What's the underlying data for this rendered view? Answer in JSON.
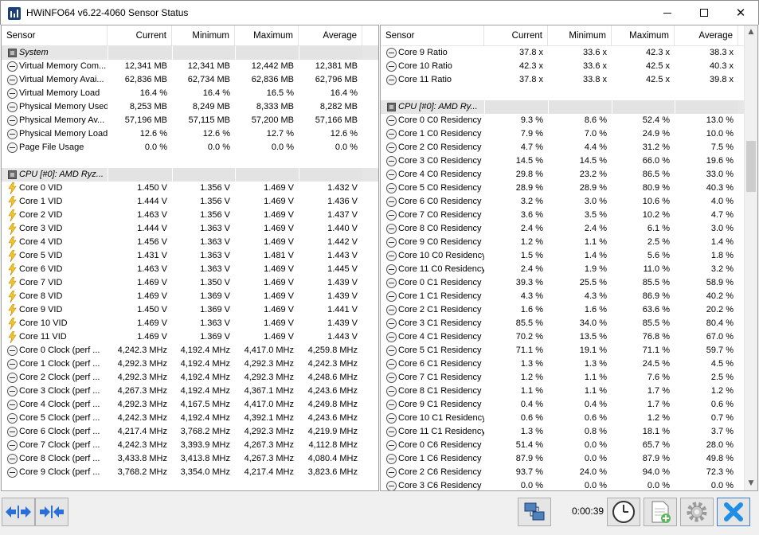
{
  "window": {
    "title": "HWiNFO64 v6.22-4060 Sensor Status",
    "minimize_glyph": "—",
    "maximize_glyph": "☐",
    "close_glyph": "✕"
  },
  "columns": {
    "sensor": "Sensor",
    "current": "Current",
    "minimum": "Minimum",
    "maximum": "Maximum",
    "average": "Average"
  },
  "left_rows": [
    {
      "kind": "group",
      "icon": "chip-icon",
      "name": "System"
    },
    {
      "kind": "row",
      "icon": "gauge-icon",
      "name": "Virtual Memory Com...",
      "current": "12,341 MB",
      "minimum": "12,341 MB",
      "maximum": "12,442 MB",
      "average": "12,381 MB"
    },
    {
      "kind": "row",
      "icon": "gauge-icon",
      "name": "Virtual Memory Avai...",
      "current": "62,836 MB",
      "minimum": "62,734 MB",
      "maximum": "62,836 MB",
      "average": "62,796 MB"
    },
    {
      "kind": "row",
      "icon": "gauge-icon",
      "name": "Virtual Memory Load",
      "current": "16.4 %",
      "minimum": "16.4 %",
      "maximum": "16.5 %",
      "average": "16.4 %"
    },
    {
      "kind": "row",
      "icon": "gauge-icon",
      "name": "Physical Memory Used",
      "current": "8,253 MB",
      "minimum": "8,249 MB",
      "maximum": "8,333 MB",
      "average": "8,282 MB"
    },
    {
      "kind": "row",
      "icon": "gauge-icon",
      "name": "Physical Memory Av...",
      "current": "57,196 MB",
      "minimum": "57,115 MB",
      "maximum": "57,200 MB",
      "average": "57,166 MB"
    },
    {
      "kind": "row",
      "icon": "gauge-icon",
      "name": "Physical Memory Load",
      "current": "12.6 %",
      "minimum": "12.6 %",
      "maximum": "12.7 %",
      "average": "12.6 %"
    },
    {
      "kind": "row",
      "icon": "gauge-icon",
      "name": "Page File Usage",
      "current": "0.0 %",
      "minimum": "0.0 %",
      "maximum": "0.0 %",
      "average": "0.0 %"
    },
    {
      "kind": "blank"
    },
    {
      "kind": "group",
      "icon": "chip-icon",
      "name": "CPU [#0]: AMD Ryz..."
    },
    {
      "kind": "row",
      "icon": "bolt-icon",
      "name": "Core 0 VID",
      "current": "1.450 V",
      "minimum": "1.356 V",
      "maximum": "1.469 V",
      "average": "1.432 V"
    },
    {
      "kind": "row",
      "icon": "bolt-icon",
      "name": "Core 1 VID",
      "current": "1.444 V",
      "minimum": "1.356 V",
      "maximum": "1.469 V",
      "average": "1.436 V"
    },
    {
      "kind": "row",
      "icon": "bolt-icon",
      "name": "Core 2 VID",
      "current": "1.463 V",
      "minimum": "1.356 V",
      "maximum": "1.469 V",
      "average": "1.437 V"
    },
    {
      "kind": "row",
      "icon": "bolt-icon",
      "name": "Core 3 VID",
      "current": "1.444 V",
      "minimum": "1.363 V",
      "maximum": "1.469 V",
      "average": "1.440 V"
    },
    {
      "kind": "row",
      "icon": "bolt-icon",
      "name": "Core 4 VID",
      "current": "1.456 V",
      "minimum": "1.363 V",
      "maximum": "1.469 V",
      "average": "1.442 V"
    },
    {
      "kind": "row",
      "icon": "bolt-icon",
      "name": "Core 5 VID",
      "current": "1.431 V",
      "minimum": "1.363 V",
      "maximum": "1.481 V",
      "average": "1.443 V"
    },
    {
      "kind": "row",
      "icon": "bolt-icon",
      "name": "Core 6 VID",
      "current": "1.463 V",
      "minimum": "1.363 V",
      "maximum": "1.469 V",
      "average": "1.445 V"
    },
    {
      "kind": "row",
      "icon": "bolt-icon",
      "name": "Core 7 VID",
      "current": "1.469 V",
      "minimum": "1.350 V",
      "maximum": "1.469 V",
      "average": "1.439 V"
    },
    {
      "kind": "row",
      "icon": "bolt-icon",
      "name": "Core 8 VID",
      "current": "1.469 V",
      "minimum": "1.369 V",
      "maximum": "1.469 V",
      "average": "1.439 V"
    },
    {
      "kind": "row",
      "icon": "bolt-icon",
      "name": "Core 9 VID",
      "current": "1.450 V",
      "minimum": "1.369 V",
      "maximum": "1.469 V",
      "average": "1.441 V"
    },
    {
      "kind": "row",
      "icon": "bolt-icon",
      "name": "Core 10 VID",
      "current": "1.469 V",
      "minimum": "1.363 V",
      "maximum": "1.469 V",
      "average": "1.439 V"
    },
    {
      "kind": "row",
      "icon": "bolt-icon",
      "name": "Core 11 VID",
      "current": "1.469 V",
      "minimum": "1.369 V",
      "maximum": "1.469 V",
      "average": "1.443 V"
    },
    {
      "kind": "row",
      "icon": "gauge-icon",
      "name": "Core 0 Clock (perf ...",
      "current": "4,242.3 MHz",
      "minimum": "4,192.4 MHz",
      "maximum": "4,417.0 MHz",
      "average": "4,259.8 MHz"
    },
    {
      "kind": "row",
      "icon": "gauge-icon",
      "name": "Core 1 Clock (perf ...",
      "current": "4,292.3 MHz",
      "minimum": "4,192.4 MHz",
      "maximum": "4,292.3 MHz",
      "average": "4,242.3 MHz"
    },
    {
      "kind": "row",
      "icon": "gauge-icon",
      "name": "Core 2 Clock (perf ...",
      "current": "4,292.3 MHz",
      "minimum": "4,192.4 MHz",
      "maximum": "4,292.3 MHz",
      "average": "4,248.6 MHz"
    },
    {
      "kind": "row",
      "icon": "gauge-icon",
      "name": "Core 3 Clock (perf ...",
      "current": "4,267.3 MHz",
      "minimum": "4,192.4 MHz",
      "maximum": "4,367.1 MHz",
      "average": "4,243.6 MHz"
    },
    {
      "kind": "row",
      "icon": "gauge-icon",
      "name": "Core 4 Clock (perf ...",
      "current": "4,292.3 MHz",
      "minimum": "4,167.5 MHz",
      "maximum": "4,417.0 MHz",
      "average": "4,249.8 MHz"
    },
    {
      "kind": "row",
      "icon": "gauge-icon",
      "name": "Core 5 Clock (perf ...",
      "current": "4,242.3 MHz",
      "minimum": "4,192.4 MHz",
      "maximum": "4,392.1 MHz",
      "average": "4,243.6 MHz"
    },
    {
      "kind": "row",
      "icon": "gauge-icon",
      "name": "Core 6 Clock (perf ...",
      "current": "4,217.4 MHz",
      "minimum": "3,768.2 MHz",
      "maximum": "4,292.3 MHz",
      "average": "4,219.9 MHz"
    },
    {
      "kind": "row",
      "icon": "gauge-icon",
      "name": "Core 7 Clock (perf ...",
      "current": "4,242.3 MHz",
      "minimum": "3,393.9 MHz",
      "maximum": "4,267.3 MHz",
      "average": "4,112.8 MHz"
    },
    {
      "kind": "row",
      "icon": "gauge-icon",
      "name": "Core 8 Clock (perf ...",
      "current": "3,433.8 MHz",
      "minimum": "3,413.8 MHz",
      "maximum": "4,267.3 MHz",
      "average": "4,080.4 MHz"
    },
    {
      "kind": "row",
      "icon": "gauge-icon",
      "name": "Core 9 Clock (perf ...",
      "current": "3,768.2 MHz",
      "minimum": "3,354.0 MHz",
      "maximum": "4,217.4 MHz",
      "average": "3,823.6 MHz"
    }
  ],
  "right_rows": [
    {
      "kind": "row",
      "icon": "gauge-icon",
      "name": "Core 9 Ratio",
      "current": "37.8 x",
      "minimum": "33.6 x",
      "maximum": "42.3 x",
      "average": "38.3 x"
    },
    {
      "kind": "row",
      "icon": "gauge-icon",
      "name": "Core 10 Ratio",
      "current": "42.3 x",
      "minimum": "33.6 x",
      "maximum": "42.5 x",
      "average": "40.3 x"
    },
    {
      "kind": "row",
      "icon": "gauge-icon",
      "name": "Core 11 Ratio",
      "current": "37.8 x",
      "minimum": "33.8 x",
      "maximum": "42.5 x",
      "average": "39.8 x"
    },
    {
      "kind": "blank"
    },
    {
      "kind": "group",
      "icon": "chip-icon",
      "name": "CPU [#0]: AMD Ry..."
    },
    {
      "kind": "row",
      "icon": "gauge-icon",
      "name": "Core 0 C0 Residency",
      "current": "9.3 %",
      "minimum": "8.6 %",
      "maximum": "52.4 %",
      "average": "13.0 %"
    },
    {
      "kind": "row",
      "icon": "gauge-icon",
      "name": "Core 1 C0 Residency",
      "current": "7.9 %",
      "minimum": "7.0 %",
      "maximum": "24.9 %",
      "average": "10.0 %"
    },
    {
      "kind": "row",
      "icon": "gauge-icon",
      "name": "Core 2 C0 Residency",
      "current": "4.7 %",
      "minimum": "4.4 %",
      "maximum": "31.2 %",
      "average": "7.5 %"
    },
    {
      "kind": "row",
      "icon": "gauge-icon",
      "name": "Core 3 C0 Residency",
      "current": "14.5 %",
      "minimum": "14.5 %",
      "maximum": "66.0 %",
      "average": "19.6 %"
    },
    {
      "kind": "row",
      "icon": "gauge-icon",
      "name": "Core 4 C0 Residency",
      "current": "29.8 %",
      "minimum": "23.2 %",
      "maximum": "86.5 %",
      "average": "33.0 %"
    },
    {
      "kind": "row",
      "icon": "gauge-icon",
      "name": "Core 5 C0 Residency",
      "current": "28.9 %",
      "minimum": "28.9 %",
      "maximum": "80.9 %",
      "average": "40.3 %"
    },
    {
      "kind": "row",
      "icon": "gauge-icon",
      "name": "Core 6 C0 Residency",
      "current": "3.2 %",
      "minimum": "3.0 %",
      "maximum": "10.6 %",
      "average": "4.0 %"
    },
    {
      "kind": "row",
      "icon": "gauge-icon",
      "name": "Core 7 C0 Residency",
      "current": "3.6 %",
      "minimum": "3.5 %",
      "maximum": "10.2 %",
      "average": "4.7 %"
    },
    {
      "kind": "row",
      "icon": "gauge-icon",
      "name": "Core 8 C0 Residency",
      "current": "2.4 %",
      "minimum": "2.4 %",
      "maximum": "6.1 %",
      "average": "3.0 %"
    },
    {
      "kind": "row",
      "icon": "gauge-icon",
      "name": "Core 9 C0 Residency",
      "current": "1.2 %",
      "minimum": "1.1 %",
      "maximum": "2.5 %",
      "average": "1.4 %"
    },
    {
      "kind": "row",
      "icon": "gauge-icon",
      "name": "Core 10 C0 Residency",
      "current": "1.5 %",
      "minimum": "1.4 %",
      "maximum": "5.6 %",
      "average": "1.8 %"
    },
    {
      "kind": "row",
      "icon": "gauge-icon",
      "name": "Core 11 C0 Residency",
      "current": "2.4 %",
      "minimum": "1.9 %",
      "maximum": "11.0 %",
      "average": "3.2 %"
    },
    {
      "kind": "row",
      "icon": "gauge-icon",
      "name": "Core 0 C1 Residency",
      "current": "39.3 %",
      "minimum": "25.5 %",
      "maximum": "85.5 %",
      "average": "58.9 %"
    },
    {
      "kind": "row",
      "icon": "gauge-icon",
      "name": "Core 1 C1 Residency",
      "current": "4.3 %",
      "minimum": "4.3 %",
      "maximum": "86.9 %",
      "average": "40.2 %"
    },
    {
      "kind": "row",
      "icon": "gauge-icon",
      "name": "Core 2 C1 Residency",
      "current": "1.6 %",
      "minimum": "1.6 %",
      "maximum": "63.6 %",
      "average": "20.2 %"
    },
    {
      "kind": "row",
      "icon": "gauge-icon",
      "name": "Core 3 C1 Residency",
      "current": "85.5 %",
      "minimum": "34.0 %",
      "maximum": "85.5 %",
      "average": "80.4 %"
    },
    {
      "kind": "row",
      "icon": "gauge-icon",
      "name": "Core 4 C1 Residency",
      "current": "70.2 %",
      "minimum": "13.5 %",
      "maximum": "76.8 %",
      "average": "67.0 %"
    },
    {
      "kind": "row",
      "icon": "gauge-icon",
      "name": "Core 5 C1 Residency",
      "current": "71.1 %",
      "minimum": "19.1 %",
      "maximum": "71.1 %",
      "average": "59.7 %"
    },
    {
      "kind": "row",
      "icon": "gauge-icon",
      "name": "Core 6 C1 Residency",
      "current": "1.3 %",
      "minimum": "1.3 %",
      "maximum": "24.5 %",
      "average": "4.5 %"
    },
    {
      "kind": "row",
      "icon": "gauge-icon",
      "name": "Core 7 C1 Residency",
      "current": "1.2 %",
      "minimum": "1.1 %",
      "maximum": "7.6 %",
      "average": "2.5 %"
    },
    {
      "kind": "row",
      "icon": "gauge-icon",
      "name": "Core 8 C1 Residency",
      "current": "1.1 %",
      "minimum": "1.1 %",
      "maximum": "1.7 %",
      "average": "1.2 %"
    },
    {
      "kind": "row",
      "icon": "gauge-icon",
      "name": "Core 9 C1 Residency",
      "current": "0.4 %",
      "minimum": "0.4 %",
      "maximum": "1.7 %",
      "average": "0.6 %"
    },
    {
      "kind": "row",
      "icon": "gauge-icon",
      "name": "Core 10 C1 Residency",
      "current": "0.6 %",
      "minimum": "0.6 %",
      "maximum": "1.2 %",
      "average": "0.7 %"
    },
    {
      "kind": "row",
      "icon": "gauge-icon",
      "name": "Core 11 C1 Residency",
      "current": "1.3 %",
      "minimum": "0.8 %",
      "maximum": "18.1 %",
      "average": "3.7 %"
    },
    {
      "kind": "row",
      "icon": "gauge-icon",
      "name": "Core 0 C6 Residency",
      "current": "51.4 %",
      "minimum": "0.0 %",
      "maximum": "65.7 %",
      "average": "28.0 %"
    },
    {
      "kind": "row",
      "icon": "gauge-icon",
      "name": "Core 1 C6 Residency",
      "current": "87.9 %",
      "minimum": "0.0 %",
      "maximum": "87.9 %",
      "average": "49.8 %"
    },
    {
      "kind": "row",
      "icon": "gauge-icon",
      "name": "Core 2 C6 Residency",
      "current": "93.7 %",
      "minimum": "24.0 %",
      "maximum": "94.0 %",
      "average": "72.3 %"
    },
    {
      "kind": "row",
      "icon": "gauge-icon",
      "name": "Core 3 C6 Residency",
      "current": "0.0 %",
      "minimum": "0.0 %",
      "maximum": "0.0 %",
      "average": "0.0 %"
    }
  ],
  "toolbar": {
    "elapsed_time": "0:00:39",
    "buttons": [
      "expand-columns-icon",
      "collapse-columns-icon",
      "network-icon",
      "clock-icon",
      "add-report-icon",
      "settings-gear-icon",
      "close-x-icon"
    ]
  },
  "colors": {
    "group_row_bg": "#e6e6e6",
    "bolt_yellow": "#f6c52a",
    "accent_blue": "#2a6fd6",
    "close_blue": "#1e8ee6"
  }
}
